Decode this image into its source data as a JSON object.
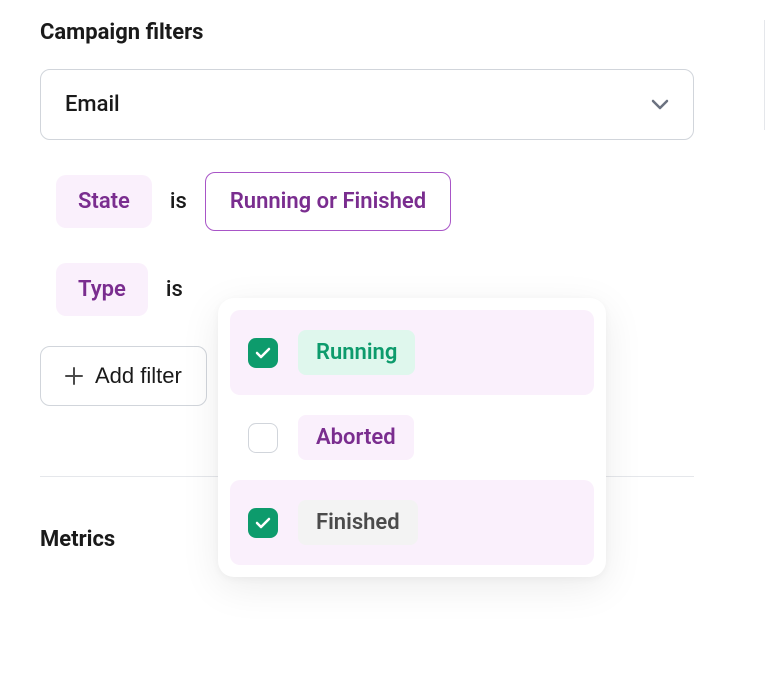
{
  "section": {
    "filters_title": "Campaign filters",
    "metrics_title": "Metrics"
  },
  "channel_dropdown": {
    "value": "Email"
  },
  "filters": {
    "state": {
      "field_label": "State",
      "operator": "is",
      "value": "Running or Finished"
    },
    "type": {
      "field_label": "Type",
      "operator": "is"
    }
  },
  "add_filter_label": "Add filter",
  "state_options": [
    {
      "label": "Running",
      "checked": true,
      "style": "option-running",
      "selected_bg": true
    },
    {
      "label": "Aborted",
      "checked": false,
      "style": "option-aborted",
      "selected_bg": false
    },
    {
      "label": "Finished",
      "checked": true,
      "style": "option-finished",
      "selected_bg": true
    }
  ]
}
